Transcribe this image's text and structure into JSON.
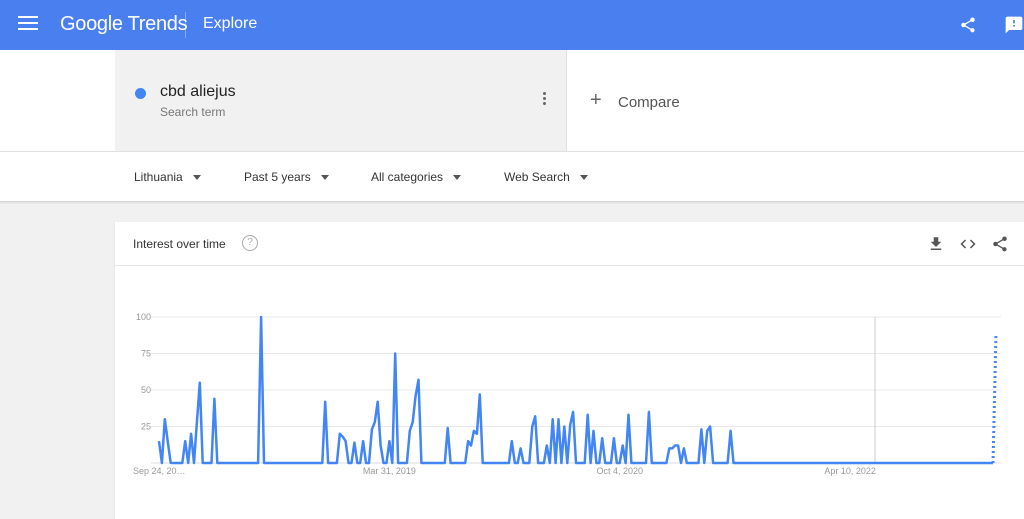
{
  "header": {
    "logo_text": "Google Trends",
    "title": "Explore",
    "icons": [
      "menu-icon",
      "share-icon",
      "feedback-icon"
    ],
    "bar_color": "#4a7ff0"
  },
  "search": {
    "term": "cbd aliejus",
    "term_type": "Search term",
    "term_color": "#4285f4",
    "compare_label": "Compare"
  },
  "filters": {
    "region": "Lithuania",
    "time": "Past 5 years",
    "category": "All categories",
    "property": "Web Search"
  },
  "card": {
    "title": "Interest over time",
    "help": "?"
  },
  "chart_data": {
    "type": "line",
    "title": "Interest over time",
    "xlabel": "",
    "ylabel": "",
    "ylim": [
      0,
      100
    ],
    "y_ticks": [
      25,
      50,
      75,
      100
    ],
    "x_tick_labels": [
      "Sep 24, 20…",
      "Mar 31, 2019",
      "Oct 4, 2020",
      "Apr 10, 2022"
    ],
    "x_tick_weeks": [
      0,
      79,
      158,
      237
    ],
    "grid": true,
    "series": [
      {
        "color": "#4285f4",
        "partial_last_point": 89,
        "values": [
          15,
          0,
          30,
          15,
          0,
          0,
          0,
          0,
          0,
          15,
          0,
          20,
          0,
          28,
          55,
          0,
          0,
          0,
          0,
          44,
          0,
          0,
          0,
          0,
          0,
          0,
          0,
          0,
          0,
          0,
          0,
          0,
          0,
          0,
          0,
          100,
          0,
          0,
          0,
          0,
          0,
          0,
          0,
          0,
          0,
          0,
          0,
          0,
          0,
          0,
          0,
          0,
          0,
          0,
          0,
          0,
          0,
          42,
          0,
          0,
          0,
          0,
          20,
          18,
          15,
          0,
          0,
          14,
          0,
          0,
          15,
          0,
          0,
          23,
          28,
          42,
          12,
          0,
          0,
          15,
          0,
          75,
          0,
          0,
          0,
          0,
          22,
          28,
          46,
          57,
          0,
          0,
          0,
          0,
          0,
          0,
          0,
          0,
          0,
          24,
          0,
          0,
          0,
          0,
          0,
          0,
          15,
          12,
          22,
          20,
          47,
          0,
          0,
          0,
          0,
          0,
          0,
          0,
          0,
          0,
          0,
          15,
          0,
          0,
          10,
          0,
          0,
          0,
          25,
          32,
          0,
          0,
          0,
          12,
          0,
          30,
          0,
          30,
          0,
          25,
          0,
          26,
          35,
          0,
          0,
          0,
          0,
          33,
          0,
          22,
          0,
          0,
          17,
          0,
          0,
          0,
          17,
          0,
          0,
          12,
          0,
          33,
          0,
          0,
          0,
          0,
          0,
          0,
          35,
          0,
          0,
          0,
          0,
          0,
          0,
          10,
          10,
          12,
          12,
          0,
          10,
          0,
          0,
          0,
          0,
          0,
          23,
          0,
          22,
          25,
          0,
          0,
          0,
          0,
          0,
          0,
          22,
          0,
          0,
          0,
          0,
          0,
          0,
          0,
          0,
          0,
          0,
          0,
          0,
          0,
          0,
          0,
          0,
          0,
          0,
          0,
          0,
          0,
          0,
          0,
          0,
          0,
          0,
          0,
          0,
          0,
          0,
          0,
          0,
          0,
          0,
          0,
          0,
          0,
          0,
          0,
          0,
          0,
          0,
          0,
          0,
          0,
          0,
          0,
          0,
          0,
          0,
          0,
          0,
          0,
          0,
          0,
          0,
          0,
          0,
          0,
          0,
          0,
          0,
          0,
          0,
          0,
          0,
          0,
          0,
          0,
          0,
          0,
          0,
          0,
          0,
          0,
          0,
          0,
          0,
          0,
          0,
          0,
          0,
          0,
          0,
          0,
          0,
          0,
          0,
          0,
          0
        ]
      }
    ]
  }
}
